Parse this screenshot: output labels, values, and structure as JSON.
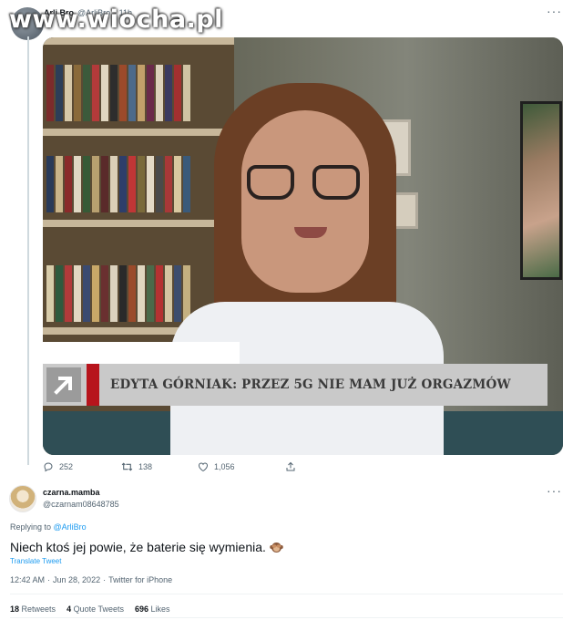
{
  "watermark": "www.wiocha.pl",
  "parent_tweet": {
    "author_name": "Arli.Bro",
    "author_handle": "@ArliBro",
    "time": "· 11h",
    "headline": "EDYTA GÓRNIAK: PRZEZ 5G NIE MAM JUŻ ORGAZMÓW",
    "replies": "252",
    "retweets": "138",
    "likes": "1,056"
  },
  "reply_tweet": {
    "author_name": "czarna.mamba",
    "author_handle": "@czarnam08648785",
    "replying_prefix": "Replying to",
    "replying_to": "@ArliBro",
    "text": "Niech ktoś jej powie, że baterie się wymienia.",
    "emoji": "see-no-evil-monkey-icon",
    "translate_label": "Translate Tweet",
    "time": "12:42 AM",
    "date": "Jun 28, 2022",
    "source": "Twitter for iPhone",
    "separator": "·"
  },
  "stats": {
    "retweets_count": "18",
    "retweets_label": "Retweets",
    "quotes_count": "4",
    "quotes_label": "Quote Tweets",
    "likes_count": "696",
    "likes_label": "Likes"
  },
  "colors": {
    "link": "#1d9bf0",
    "muted": "#536471",
    "ticker_red": "#b7141c"
  }
}
